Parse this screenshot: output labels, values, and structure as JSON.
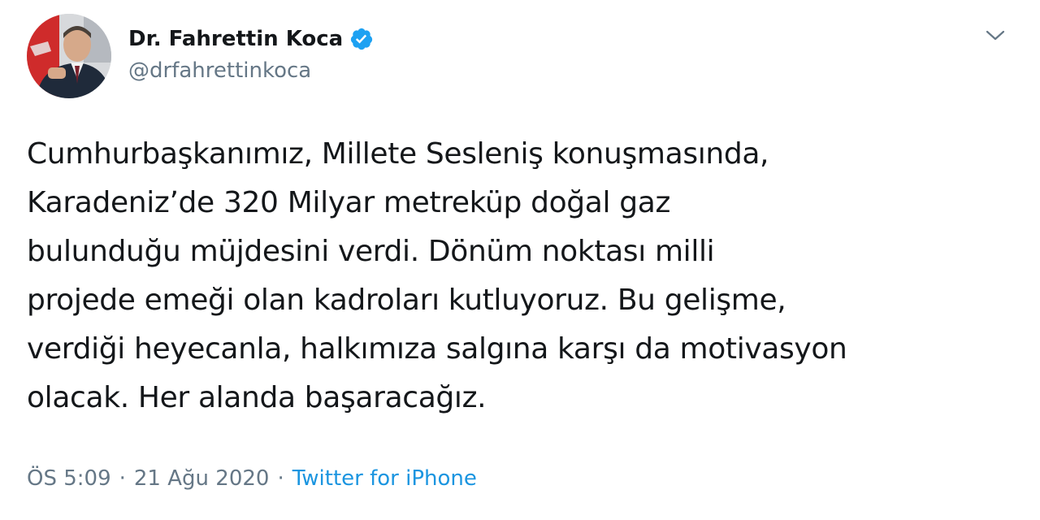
{
  "author": {
    "display_name": "Dr. Fahrettin Koca",
    "handle": "@drfahrettinkoca",
    "verified": true,
    "avatar": "profile-photo"
  },
  "tweet": {
    "lines": [
      "Cumhurbaşkanımız, Millete Sesleniş konuşmasında,",
      "Karadeniz’de 320 Milyar metreküp doğal gaz",
      "bulunduğu müjdesini verdi. Dönüm noktası milli",
      "projede emeği olan kadroları kutluyoruz. Bu gelişme,",
      "verdiği heyecanla, halkımıza salgına karşı da motivasyon",
      "olacak. Her alanda başaracağız."
    ],
    "time": "ÖS 5:09",
    "separator": "·",
    "date": "21 Ağu 2020",
    "source": "Twitter for iPhone"
  },
  "icons": {
    "verified": "verified-badge-icon",
    "menu": "chevron-down-icon"
  },
  "colors": {
    "text": "#14171a",
    "secondary": "#657786",
    "link": "#1b95e0",
    "verified": "#1da1f2"
  }
}
